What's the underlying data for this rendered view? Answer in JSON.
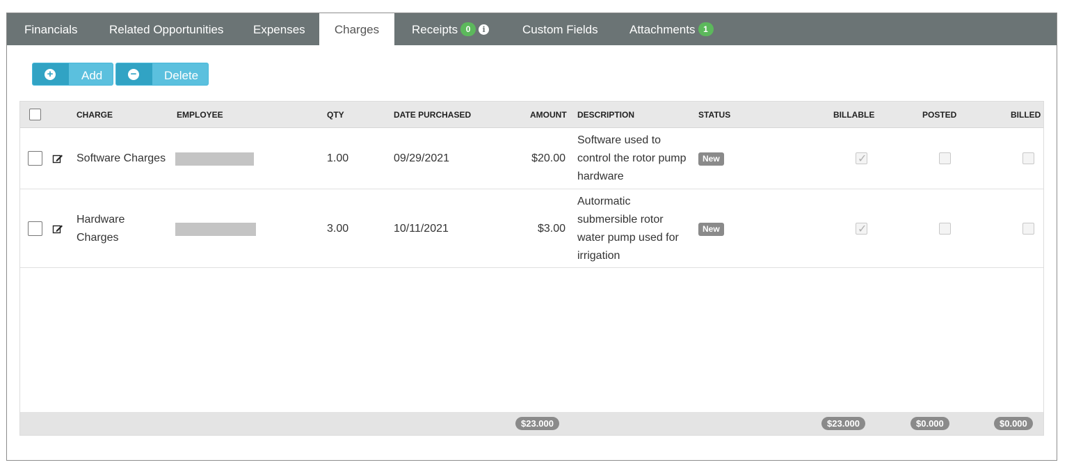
{
  "tabs": [
    {
      "label": "Financials"
    },
    {
      "label": "Related Opportunities"
    },
    {
      "label": "Expenses"
    },
    {
      "label": "Charges"
    },
    {
      "label": "Receipts",
      "badge": "0"
    },
    {
      "label": "Custom Fields"
    },
    {
      "label": "Attachments",
      "badge": "1"
    }
  ],
  "active_tab": "Charges",
  "toolbar": {
    "add_label": "Add",
    "delete_label": "Delete"
  },
  "table": {
    "columns": [
      "CHARGE",
      "EMPLOYEE",
      "QTY",
      "DATE PURCHASED",
      "AMOUNT",
      "DESCRIPTION",
      "STATUS",
      "BILLABLE",
      "POSTED",
      "BILLED"
    ],
    "rows": [
      {
        "charge": "Software Charges",
        "employee": "",
        "qty": "1.00",
        "date_purchased": "09/29/2021",
        "amount": "$20.00",
        "description": "Software used to control the rotor pump hardware",
        "status": "New",
        "billable": true,
        "posted": false,
        "billed": false
      },
      {
        "charge": "Hardware Charges",
        "employee": "",
        "qty": "3.00",
        "date_purchased": "10/11/2021",
        "amount": "$3.00",
        "description": "Autormatic submersible rotor water pump used for irrigation",
        "status": "New",
        "billable": true,
        "posted": false,
        "billed": false
      }
    ],
    "totals": {
      "amount": "$23.000",
      "billable": "$23.000",
      "posted": "$0.000",
      "billed": "$0.000"
    }
  },
  "colors": {
    "tabbar": "#6b7475",
    "badge": "#5cb85c",
    "button": "#5bc0de",
    "button_icon": "#31a3c4",
    "status_badge": "#8a8a8a"
  }
}
